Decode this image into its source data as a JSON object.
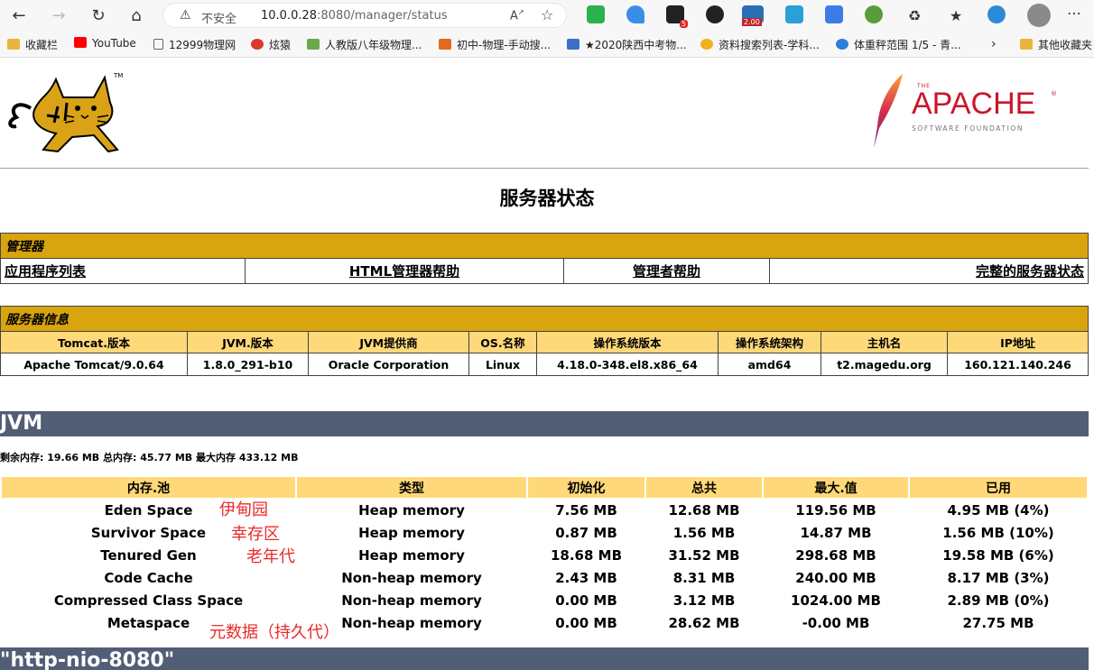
{
  "browser": {
    "insecure_label": "不安全",
    "url_host": "10.0.0.28",
    "url_path": ":8080/manager/status",
    "badge_count": "5",
    "badge_price": "2.00"
  },
  "bookmarks": [
    {
      "label": "收藏栏"
    },
    {
      "label": "YouTube"
    },
    {
      "label": "12999物理网"
    },
    {
      "label": "炫猿"
    },
    {
      "label": "人教版八年级物理..."
    },
    {
      "label": "初中-物理-手动搜..."
    },
    {
      "label": "★2020陕西中考物..."
    },
    {
      "label": "资料搜索列表-学科..."
    },
    {
      "label": "体重秤范围 1/5 - 青..."
    },
    {
      "label": "其他收藏夹"
    }
  ],
  "logos": {
    "tomcat_tm": "TM",
    "apache_the": "THE",
    "apache_name": "APACHE",
    "apache_reg": "®",
    "apache_sub": "SOFTWARE FOUNDATION"
  },
  "page_title": "服务器状态",
  "manager": {
    "heading": "管理器",
    "links": [
      "应用程序列表",
      "HTML管理器帮助",
      "管理者帮助",
      "完整的服务器状态"
    ]
  },
  "server_info": {
    "heading": "服务器信息",
    "headers": [
      "Tomcat.版本",
      "JVM.版本",
      "JVM提供商",
      "OS.名称",
      "操作系统版本",
      "操作系统架构",
      "主机名",
      "IP地址"
    ],
    "values": [
      "Apache Tomcat/9.0.64",
      "1.8.0_291-b10",
      "Oracle Corporation",
      "Linux",
      "4.18.0-348.el8.x86_64",
      "amd64",
      "t2.magedu.org",
      "160.121.140.246"
    ]
  },
  "jvm": {
    "heading": "JVM",
    "memory_line": "剩余内存:   19.66 MB 总内存:   45.77 MB 最大内存 433.12 MB",
    "headers": [
      "内存.池",
      "类型",
      "初始化",
      "总共",
      "最大.值",
      "已用"
    ],
    "rows": [
      [
        "Eden Space",
        "Heap memory",
        "7.56 MB",
        "12.68 MB",
        "119.56 MB",
        "4.95 MB (4%)"
      ],
      [
        "Survivor Space",
        "Heap memory",
        "0.87 MB",
        "1.56 MB",
        "14.87 MB",
        "1.56 MB (10%)"
      ],
      [
        "Tenured Gen",
        "Heap memory",
        "18.68 MB",
        "31.52 MB",
        "298.68 MB",
        "19.58 MB (6%)"
      ],
      [
        "Code Cache",
        "Non-heap memory",
        "2.43 MB",
        "8.31 MB",
        "240.00 MB",
        "8.17 MB (3%)"
      ],
      [
        "Compressed Class Space",
        "Non-heap memory",
        "0.00 MB",
        "3.12 MB",
        "1024.00 MB",
        "2.89 MB (0%)"
      ],
      [
        "Metaspace",
        "Non-heap memory",
        "0.00 MB",
        "28.62 MB",
        "-0.00 MB",
        "27.75 MB"
      ]
    ],
    "annotations": [
      "伊甸园",
      "幸存区",
      "老年代",
      "元数据（持久代）"
    ]
  },
  "connector": {
    "heading": "\"http-nio-8080\""
  }
}
